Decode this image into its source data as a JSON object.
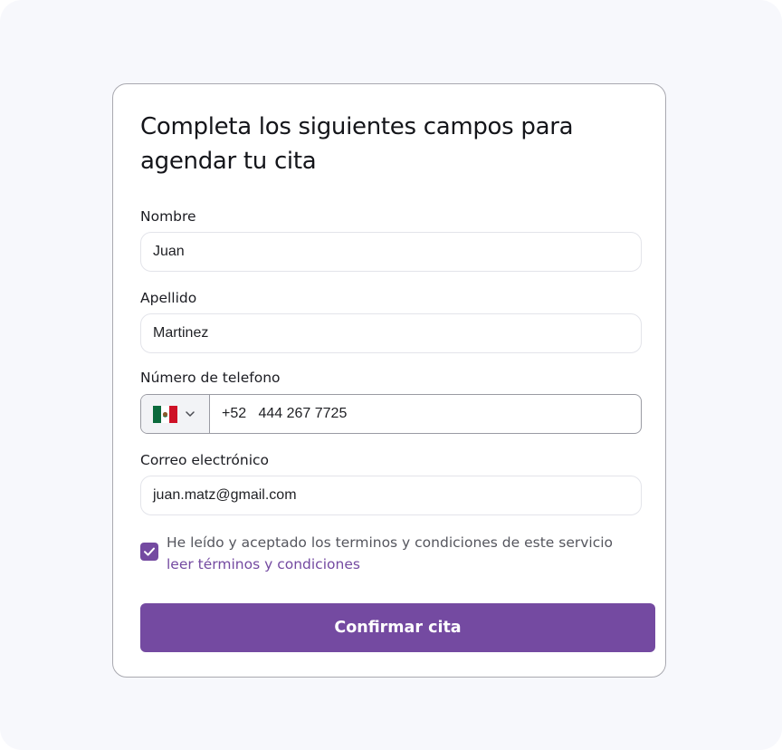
{
  "form": {
    "title": "Completa los siguientes campos para agendar tu cita",
    "fields": {
      "nombre": {
        "label": "Nombre",
        "value": "Juan"
      },
      "apellido": {
        "label": "Apellido",
        "value": "Martinez"
      },
      "telefono": {
        "label": "Número de telefono",
        "country_flag": "mexico-flag-icon",
        "dial_code": "+52",
        "number": "444 267 7725",
        "display": "+52   444 267 7725"
      },
      "correo": {
        "label": "Correo electrónico",
        "value": "juan.matz@gmail.com"
      }
    },
    "terms": {
      "checked": true,
      "text": "He leído y aceptado los terminos y condiciones  de este servicio",
      "link": "leer términos y condiciones"
    },
    "submit_label": "Confirmar cita"
  },
  "colors": {
    "accent": "#744aa1",
    "background": "#f7f8fc",
    "card_border": "#a9a9b0",
    "input_border": "#e3e4ea"
  }
}
